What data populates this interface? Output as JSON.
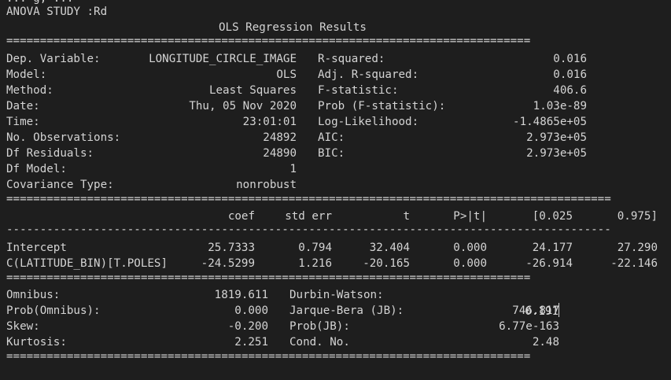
{
  "top_cut_text": "ANOVA STUDY :Rd",
  "prev_line_fragment": "... g, ...",
  "title": "OLS Regression Results",
  "separator_double": "==============================================================================",
  "separator_single": "------------------------------------------------------------------------------------------",
  "separator_double_wide": "==========================================================================================",
  "summary": {
    "left": [
      {
        "label": "Dep. Variable:",
        "value": "LONGITUDE_CIRCLE_IMAGE"
      },
      {
        "label": "Model:",
        "value": "OLS"
      },
      {
        "label": "Method:",
        "value": "Least Squares"
      },
      {
        "label": "Date:",
        "value": "Thu, 05 Nov 2020"
      },
      {
        "label": "Time:",
        "value": "23:01:01"
      },
      {
        "label": "No. Observations:",
        "value": "24892"
      },
      {
        "label": "Df Residuals:",
        "value": "24890"
      },
      {
        "label": "Df Model:",
        "value": "1"
      },
      {
        "label": "Covariance Type:",
        "value": "nonrobust"
      }
    ],
    "right": [
      {
        "label": "R-squared:",
        "value": "0.016"
      },
      {
        "label": "Adj. R-squared:",
        "value": "0.016"
      },
      {
        "label": "F-statistic:",
        "value": "406.6"
      },
      {
        "label": "Prob (F-statistic):",
        "value": "1.03e-89"
      },
      {
        "label": "Log-Likelihood:",
        "value": "-1.4865e+05"
      },
      {
        "label": "AIC:",
        "value": "2.973e+05"
      },
      {
        "label": "BIC:",
        "value": "2.973e+05"
      }
    ]
  },
  "coef_table": {
    "headers": [
      "coef",
      "std err",
      "t",
      "P>|t|",
      "[0.025",
      "0.975]"
    ],
    "rows": [
      {
        "name": "Intercept",
        "values": [
          "25.7333",
          "0.794",
          "32.404",
          "0.000",
          "24.177",
          "27.290"
        ]
      },
      {
        "name": "C(LATITUDE_BIN)[T.POLES]",
        "values": [
          "-24.5299",
          "1.216",
          "-20.165",
          "0.000",
          "-26.914",
          "-22.146"
        ]
      }
    ]
  },
  "diagnostics": {
    "left": [
      {
        "label": "Omnibus:",
        "value": "1819.611"
      },
      {
        "label": "Prob(Omnibus):",
        "value": "0.000"
      },
      {
        "label": "Skew:",
        "value": "-0.200"
      },
      {
        "label": "Kurtosis:",
        "value": "2.251"
      }
    ],
    "right": [
      {
        "label": "Durbin-Watson:",
        "value": "0.191"
      },
      {
        "label": "Jarque-Bera (JB):",
        "value": "746.817"
      },
      {
        "label": "Prob(JB):",
        "value": "6.77e-163"
      },
      {
        "label": "Cond. No.",
        "value": "2.48"
      }
    ]
  }
}
